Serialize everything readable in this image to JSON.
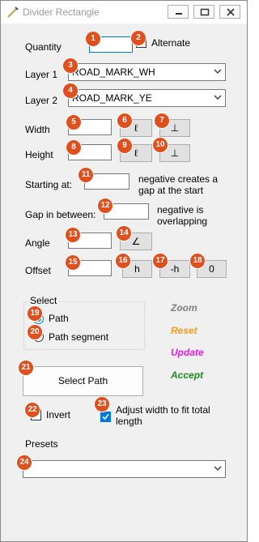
{
  "window": {
    "title": "Divider Rectangle"
  },
  "quantity": {
    "label": "Quantity",
    "value": "",
    "alternate_label": "Alternate",
    "alternate_checked": false
  },
  "layer1": {
    "label": "Layer 1",
    "value": "ROAD_MARK_WH"
  },
  "layer2": {
    "label": "Layer 2",
    "value": "ROAD_MARK_YE"
  },
  "width": {
    "label": "Width",
    "value": "",
    "btn1": "ℓ",
    "btn2": "⊥"
  },
  "height": {
    "label": "Height",
    "value": "",
    "btn1": "ℓ",
    "btn2": "⊥"
  },
  "starting": {
    "label": "Starting at:",
    "value": "",
    "note": "negative creates a gap at the start"
  },
  "gap": {
    "label": "Gap in between:",
    "value": "",
    "note": "negative is overlapping"
  },
  "angle": {
    "label": "Angle",
    "value": "",
    "btn": "∠"
  },
  "offset": {
    "label": "Offset",
    "value": "",
    "btn_h": "h",
    "btn_neg_h": "-h",
    "btn_zero": "0"
  },
  "select": {
    "group_label": "Select",
    "option_path": "Path",
    "option_segment": "Path segment",
    "selected": "path"
  },
  "actions": {
    "zoom": "Zoom",
    "reset": "Reset",
    "update": "Update",
    "accept": "Accept"
  },
  "colors": {
    "zoom": "#7f7f7f",
    "reset": "#f59a1f",
    "update": "#e020e0",
    "accept": "#1f8a1f",
    "badge": "#e0501f"
  },
  "select_path_button": "Select Path",
  "invert": {
    "label": "Invert",
    "checked": false
  },
  "adjust": {
    "label": "Adjust width to fit total length",
    "checked": true
  },
  "presets": {
    "label": "Presets",
    "value": ""
  },
  "badges": [
    "1",
    "2",
    "3",
    "4",
    "5",
    "6",
    "7",
    "8",
    "9",
    "10",
    "11",
    "12",
    "13",
    "14",
    "15",
    "16",
    "17",
    "18",
    "19",
    "20",
    "21",
    "22",
    "23",
    "24"
  ]
}
